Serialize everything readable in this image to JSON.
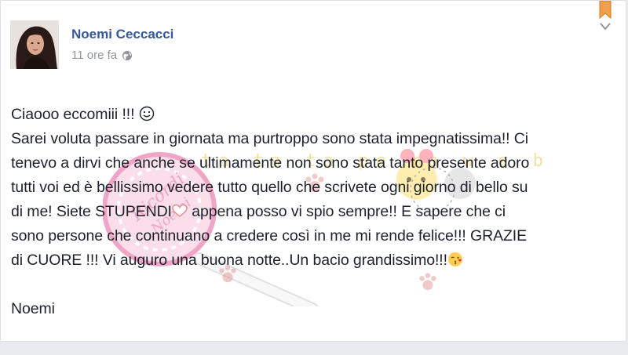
{
  "post": {
    "author_name": "Noemi Ceccacci",
    "timestamp": "11 ore fa",
    "audience_icon": "globe-icon",
    "lines": [
      "Ciaooo eccomiii !!! ",
      "Sarei voluta passare in giornata ma purtroppo sono stata impegnatissima!! Ci",
      "tenevo a dirvi che anche se ultimamente non sono stata tanto presente adoro",
      "tutti voi ed è bellissimo vedere tutto quello che scrivete ogni giorno di bello su",
      "di me! Siete STUPENDI",
      " appena posso vi spio sempre!! E sapere che ci",
      "sono persone che continuano a credere così in me mi rende felice!!! GRAZIE",
      "di CUORE !!! Vi auguro una buona notte..Un bacio grandissimo!!!"
    ],
    "signature": "Noemi"
  },
  "watermark": {
    "overlay_text": "ta ta ta pe ra w e b"
  },
  "icons": {
    "smile": "smile-emoji-icon",
    "heart": "heart-emoji-icon",
    "kiss": "kiss-emoji-icon",
    "options": "chevron-down-icon",
    "bookmark": "bookmark-icon"
  },
  "colors": {
    "author": "#365899",
    "meta": "#90949c",
    "text": "#1d2129",
    "bookmark": "#f0a04b"
  }
}
